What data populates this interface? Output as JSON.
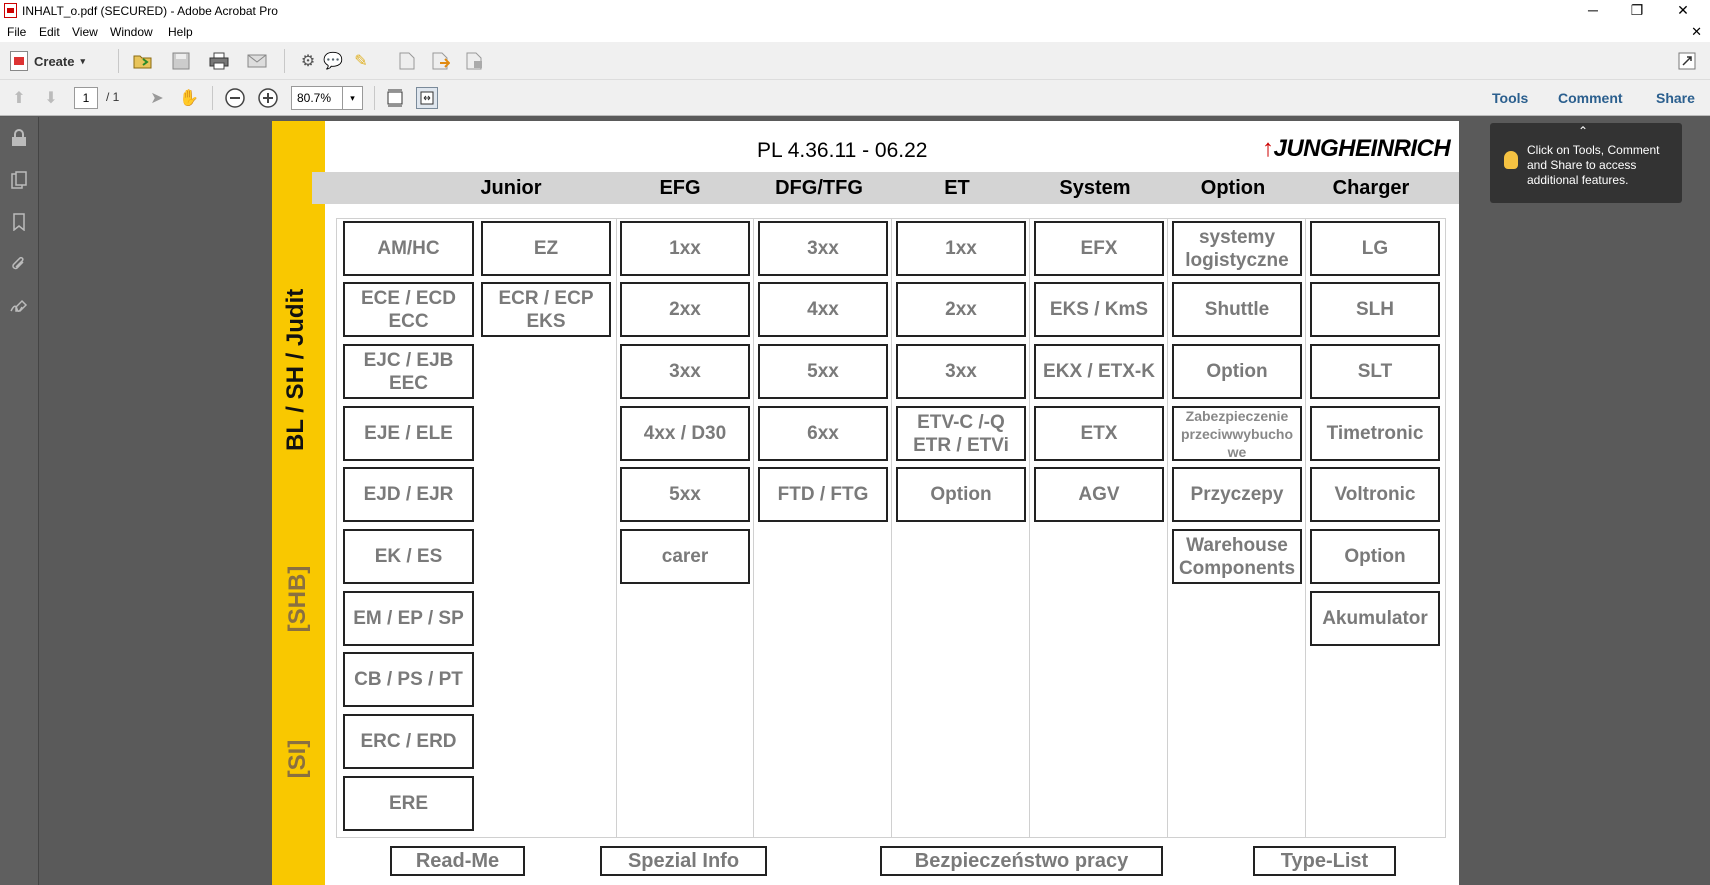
{
  "window": {
    "title": "INHALT_o.pdf (SECURED) - Adobe Acrobat Pro",
    "minimize": "─",
    "maximize": "❐",
    "close": "✕"
  },
  "menu": {
    "items": [
      "File",
      "Edit",
      "View",
      "Window",
      "Help"
    ],
    "close": "✕"
  },
  "toolbar": {
    "create_label": "Create",
    "create_caret": "▾",
    "icons": [
      "open-folder-icon",
      "save-icon",
      "print-icon",
      "email-icon",
      "gear-icon",
      "comment-icon",
      "sign-icon",
      "export-icon",
      "share-icon",
      "protect-icon"
    ],
    "expand_icon": "expand-icon"
  },
  "nav_toolbar": {
    "page_current": "1",
    "page_total": "/ 1",
    "zoom": "80.7%",
    "zoom_caret": "▾",
    "tools_label": "Tools",
    "comment_label": "Comment",
    "share_label": "Share"
  },
  "tooltip": {
    "text": "Click on Tools, Comment and Share to access additional features.",
    "caret": "⌃"
  },
  "document": {
    "title": "PL 4.36.11  -  06.22",
    "brand": "JUNGHEINRICH",
    "side_labels": [
      "BL / SH / Judit",
      "[SHB]",
      "[SI]"
    ],
    "columns": [
      "Junior",
      "EFG",
      "DFG/TFG",
      "ET",
      "System",
      "Option",
      "Charger"
    ],
    "junior_a": [
      "AM/HC",
      "ECE / ECD\nECC",
      "EJC / EJB\nEEC",
      "EJE / ELE",
      "EJD / EJR",
      "EK / ES",
      "EM / EP / SP",
      "CB / PS / PT",
      "ERC / ERD",
      "ERE"
    ],
    "junior_b": [
      "EZ",
      "ECR / ECP\nEKS"
    ],
    "efg": [
      "1xx",
      "2xx",
      "3xx",
      "4xx / D30",
      "5xx",
      "carer"
    ],
    "dfg_tfg": [
      "3xx",
      "4xx",
      "5xx",
      "6xx",
      "FTD / FTG"
    ],
    "et": [
      "1xx",
      "2xx",
      "3xx",
      "ETV-C /-Q\nETR / ETVi",
      "Option"
    ],
    "system": [
      "EFX",
      "EKS / KmS",
      "EKX / ETX-K",
      "ETX",
      "AGV"
    ],
    "option": [
      "systemy\nlogistyczne",
      "Shuttle",
      "Option",
      "Zabezpieczenie\nprzeciwwybucho\nwe",
      "Przyczepy",
      "Warehouse\nComponents"
    ],
    "charger": [
      "LG",
      "SLH",
      "SLT",
      "Timetronic",
      "Voltronic",
      "Option",
      "Akumulator"
    ],
    "footer": [
      "Read-Me",
      "Spezial Info",
      "Bezpieczeństwo pracy",
      "Type-List"
    ]
  }
}
